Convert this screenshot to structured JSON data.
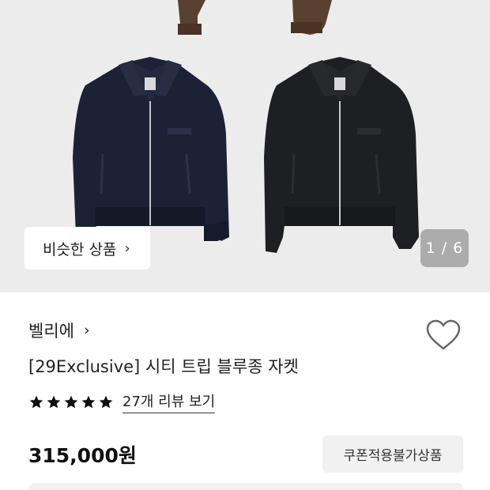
{
  "gallery": {
    "similar_label": "비슷한 상품",
    "counter": "1 / 6",
    "colors": {
      "background": "#ececec",
      "jacket_navy": "#1c2236",
      "jacket_black": "#1e1f22",
      "jacket_brown": "#5a4030"
    }
  },
  "product": {
    "brand": "벨리에",
    "title": "[29Exclusive] 시티 트립 블루종 자켓",
    "rating_stars": 5,
    "review_link": "27개 리뷰 보기",
    "price": "315,000원",
    "coupon_badge": "쿠폰적용불가상품"
  },
  "icons": {
    "similar_chevron": "chevron-right-icon",
    "brand_chevron": "chevron-right-icon",
    "wishlist": "heart-outline-icon",
    "star": "star-filled-icon"
  }
}
